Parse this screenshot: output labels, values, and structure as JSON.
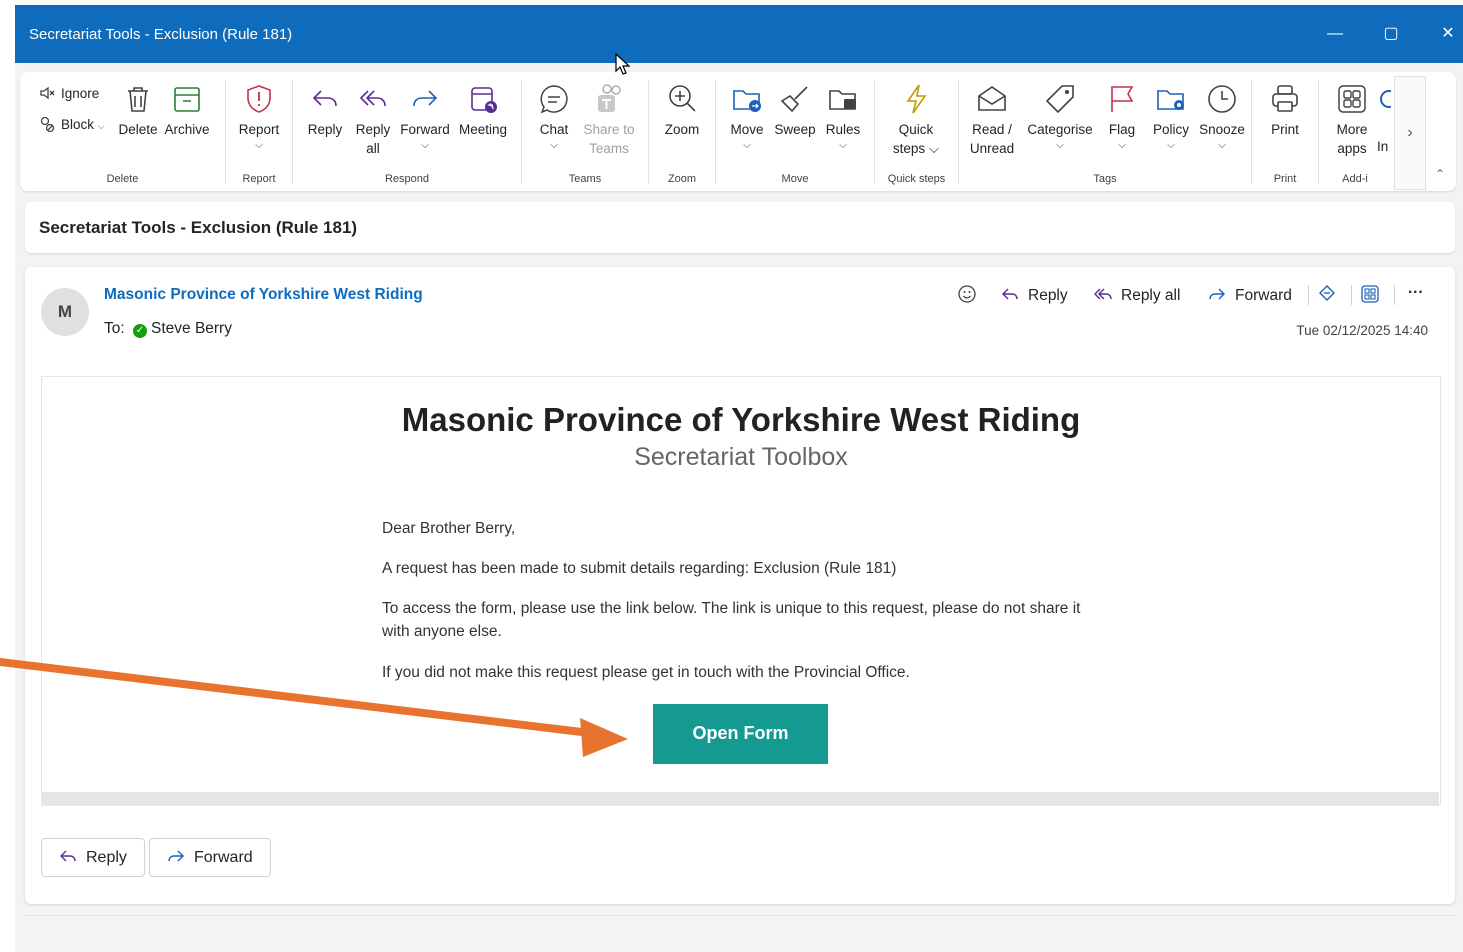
{
  "window": {
    "title": "Secretariat Tools - Exclusion (Rule 181)",
    "minimize": "—",
    "maximize": "▢",
    "close": "✕"
  },
  "ribbon": {
    "delete": {
      "ignore": "Ignore",
      "block": "Block",
      "block_chev": "⌵",
      "delete": "Delete",
      "archive": "Archive",
      "group": "Delete"
    },
    "report": {
      "report": "Report",
      "group": "Report"
    },
    "respond": {
      "reply": "Reply",
      "reply_all_1": "Reply",
      "reply_all_2": "all",
      "forward": "Forward",
      "meeting": "Meeting",
      "group": "Respond"
    },
    "teams": {
      "chat": "Chat",
      "share_1": "Share to",
      "share_2": "Teams",
      "group": "Teams"
    },
    "zoom": {
      "zoom": "Zoom",
      "group": "Zoom"
    },
    "move": {
      "move": "Move",
      "sweep": "Sweep",
      "rules": "Rules",
      "group": "Move"
    },
    "quick": {
      "quick_1": "Quick",
      "quick_2": "steps ⌵",
      "group": "Quick steps"
    },
    "tags": {
      "read_1": "Read /",
      "read_2": "Unread",
      "categorise": "Categorise",
      "flag": "Flag",
      "policy": "Policy",
      "snooze": "Snooze",
      "group": "Tags"
    },
    "print": {
      "print": "Print",
      "group": "Print"
    },
    "addins": {
      "more_1": "More",
      "more_2": "apps",
      "in": "In",
      "group": "Add-i"
    },
    "chevron": "⌵",
    "scroll_right": "›",
    "collapse": "⌃"
  },
  "subject": "Secretariat Tools - Exclusion (Rule 181)",
  "message": {
    "avatar": "M",
    "from": "Masonic Province of Yorkshire West Riding",
    "to_label": "To:",
    "to_name": "Steve Berry",
    "actions": {
      "reply": "Reply",
      "reply_all": "Reply all",
      "forward": "Forward",
      "more": "···"
    },
    "date": "Tue 02/12/2025 14:40",
    "body": {
      "heading": "Masonic Province of Yorkshire West Riding",
      "subheading": "Secretariat Toolbox",
      "greeting": "Dear Brother Berry,",
      "p1": "A request has been made to submit details regarding: Exclusion (Rule 181)",
      "p2": "To access the form, please use the link below. The link is unique to this request, please do not share it with anyone else.",
      "p3": "If you did not make this request please get in touch with the Provincial Office.",
      "cta": "Open Form"
    },
    "footer": {
      "reply": "Reply",
      "forward": "Forward"
    }
  },
  "colors": {
    "titlebar": "#0f6cbd",
    "cta": "#159a92",
    "annotation_arrow": "#e8732f",
    "link": "#0f6cbd"
  }
}
